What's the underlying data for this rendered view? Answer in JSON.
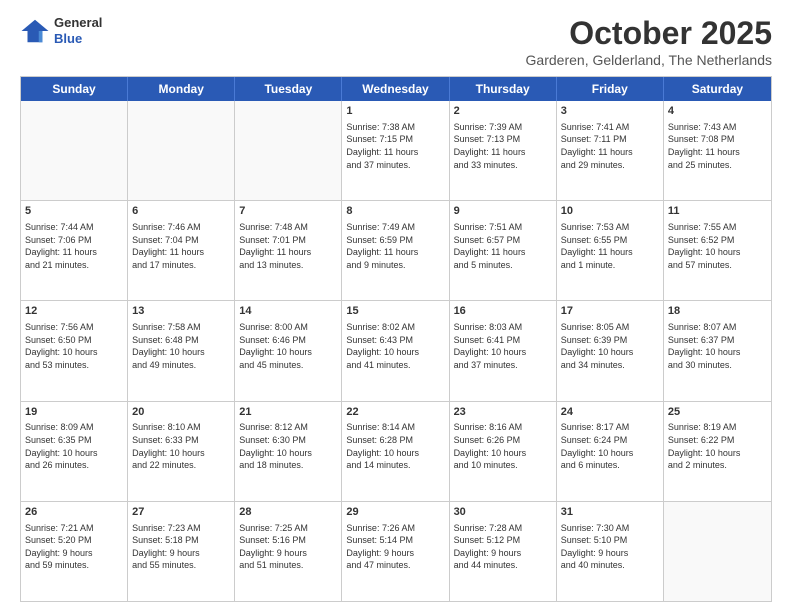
{
  "header": {
    "logo": {
      "general": "General",
      "blue": "Blue"
    },
    "title": "October 2025",
    "location": "Garderen, Gelderland, The Netherlands"
  },
  "days_of_week": [
    "Sunday",
    "Monday",
    "Tuesday",
    "Wednesday",
    "Thursday",
    "Friday",
    "Saturday"
  ],
  "weeks": [
    [
      {
        "day": "",
        "info": ""
      },
      {
        "day": "",
        "info": ""
      },
      {
        "day": "",
        "info": ""
      },
      {
        "day": "1",
        "info": "Sunrise: 7:38 AM\nSunset: 7:15 PM\nDaylight: 11 hours\nand 37 minutes."
      },
      {
        "day": "2",
        "info": "Sunrise: 7:39 AM\nSunset: 7:13 PM\nDaylight: 11 hours\nand 33 minutes."
      },
      {
        "day": "3",
        "info": "Sunrise: 7:41 AM\nSunset: 7:11 PM\nDaylight: 11 hours\nand 29 minutes."
      },
      {
        "day": "4",
        "info": "Sunrise: 7:43 AM\nSunset: 7:08 PM\nDaylight: 11 hours\nand 25 minutes."
      }
    ],
    [
      {
        "day": "5",
        "info": "Sunrise: 7:44 AM\nSunset: 7:06 PM\nDaylight: 11 hours\nand 21 minutes."
      },
      {
        "day": "6",
        "info": "Sunrise: 7:46 AM\nSunset: 7:04 PM\nDaylight: 11 hours\nand 17 minutes."
      },
      {
        "day": "7",
        "info": "Sunrise: 7:48 AM\nSunset: 7:01 PM\nDaylight: 11 hours\nand 13 minutes."
      },
      {
        "day": "8",
        "info": "Sunrise: 7:49 AM\nSunset: 6:59 PM\nDaylight: 11 hours\nand 9 minutes."
      },
      {
        "day": "9",
        "info": "Sunrise: 7:51 AM\nSunset: 6:57 PM\nDaylight: 11 hours\nand 5 minutes."
      },
      {
        "day": "10",
        "info": "Sunrise: 7:53 AM\nSunset: 6:55 PM\nDaylight: 11 hours\nand 1 minute."
      },
      {
        "day": "11",
        "info": "Sunrise: 7:55 AM\nSunset: 6:52 PM\nDaylight: 10 hours\nand 57 minutes."
      }
    ],
    [
      {
        "day": "12",
        "info": "Sunrise: 7:56 AM\nSunset: 6:50 PM\nDaylight: 10 hours\nand 53 minutes."
      },
      {
        "day": "13",
        "info": "Sunrise: 7:58 AM\nSunset: 6:48 PM\nDaylight: 10 hours\nand 49 minutes."
      },
      {
        "day": "14",
        "info": "Sunrise: 8:00 AM\nSunset: 6:46 PM\nDaylight: 10 hours\nand 45 minutes."
      },
      {
        "day": "15",
        "info": "Sunrise: 8:02 AM\nSunset: 6:43 PM\nDaylight: 10 hours\nand 41 minutes."
      },
      {
        "day": "16",
        "info": "Sunrise: 8:03 AM\nSunset: 6:41 PM\nDaylight: 10 hours\nand 37 minutes."
      },
      {
        "day": "17",
        "info": "Sunrise: 8:05 AM\nSunset: 6:39 PM\nDaylight: 10 hours\nand 34 minutes."
      },
      {
        "day": "18",
        "info": "Sunrise: 8:07 AM\nSunset: 6:37 PM\nDaylight: 10 hours\nand 30 minutes."
      }
    ],
    [
      {
        "day": "19",
        "info": "Sunrise: 8:09 AM\nSunset: 6:35 PM\nDaylight: 10 hours\nand 26 minutes."
      },
      {
        "day": "20",
        "info": "Sunrise: 8:10 AM\nSunset: 6:33 PM\nDaylight: 10 hours\nand 22 minutes."
      },
      {
        "day": "21",
        "info": "Sunrise: 8:12 AM\nSunset: 6:30 PM\nDaylight: 10 hours\nand 18 minutes."
      },
      {
        "day": "22",
        "info": "Sunrise: 8:14 AM\nSunset: 6:28 PM\nDaylight: 10 hours\nand 14 minutes."
      },
      {
        "day": "23",
        "info": "Sunrise: 8:16 AM\nSunset: 6:26 PM\nDaylight: 10 hours\nand 10 minutes."
      },
      {
        "day": "24",
        "info": "Sunrise: 8:17 AM\nSunset: 6:24 PM\nDaylight: 10 hours\nand 6 minutes."
      },
      {
        "day": "25",
        "info": "Sunrise: 8:19 AM\nSunset: 6:22 PM\nDaylight: 10 hours\nand 2 minutes."
      }
    ],
    [
      {
        "day": "26",
        "info": "Sunrise: 7:21 AM\nSunset: 5:20 PM\nDaylight: 9 hours\nand 59 minutes."
      },
      {
        "day": "27",
        "info": "Sunrise: 7:23 AM\nSunset: 5:18 PM\nDaylight: 9 hours\nand 55 minutes."
      },
      {
        "day": "28",
        "info": "Sunrise: 7:25 AM\nSunset: 5:16 PM\nDaylight: 9 hours\nand 51 minutes."
      },
      {
        "day": "29",
        "info": "Sunrise: 7:26 AM\nSunset: 5:14 PM\nDaylight: 9 hours\nand 47 minutes."
      },
      {
        "day": "30",
        "info": "Sunrise: 7:28 AM\nSunset: 5:12 PM\nDaylight: 9 hours\nand 44 minutes."
      },
      {
        "day": "31",
        "info": "Sunrise: 7:30 AM\nSunset: 5:10 PM\nDaylight: 9 hours\nand 40 minutes."
      },
      {
        "day": "",
        "info": ""
      }
    ]
  ]
}
